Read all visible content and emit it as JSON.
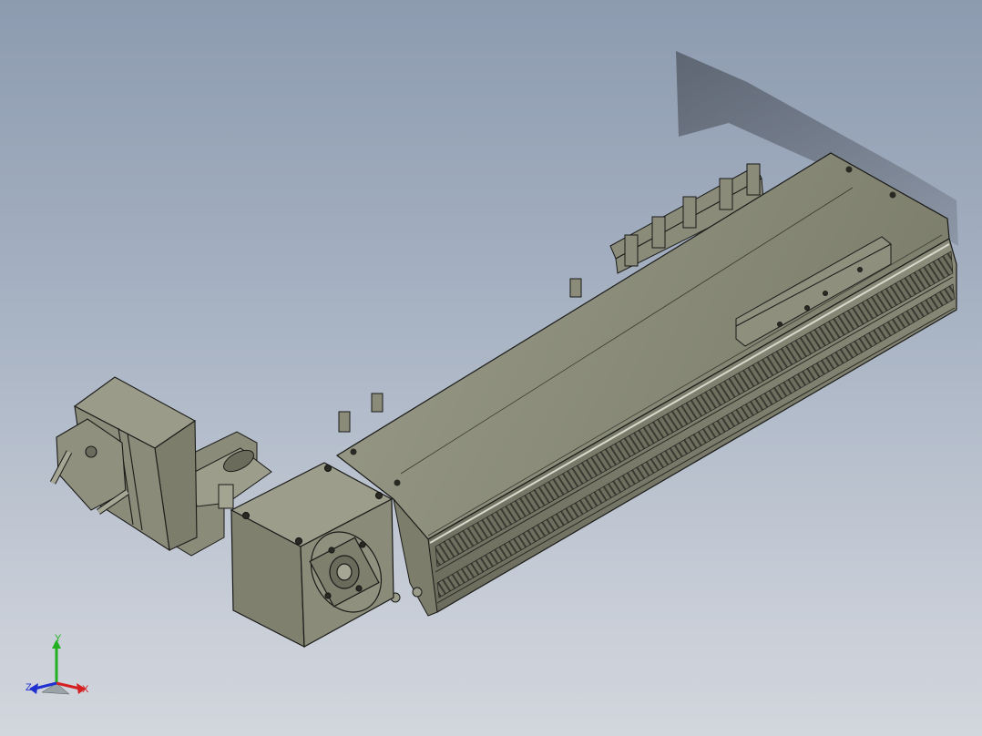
{
  "viewport": {
    "background_top": "#8d9bb0",
    "background_bottom": "#d2d6dd",
    "model_color": "#8a8b78",
    "model_edge_color": "#1a1a18",
    "shadow_color": "#3c4048"
  },
  "model": {
    "parts": [
      "linear-actuator-body",
      "carriage",
      "gearbox-housing",
      "coupling-adapter",
      "servo-motor",
      "mounting-clamps"
    ]
  },
  "triad": {
    "x_label": "X",
    "y_label": "Y",
    "z_label": "Z",
    "x_color": "#d42020",
    "y_color": "#20b020",
    "z_color": "#2030d0"
  }
}
